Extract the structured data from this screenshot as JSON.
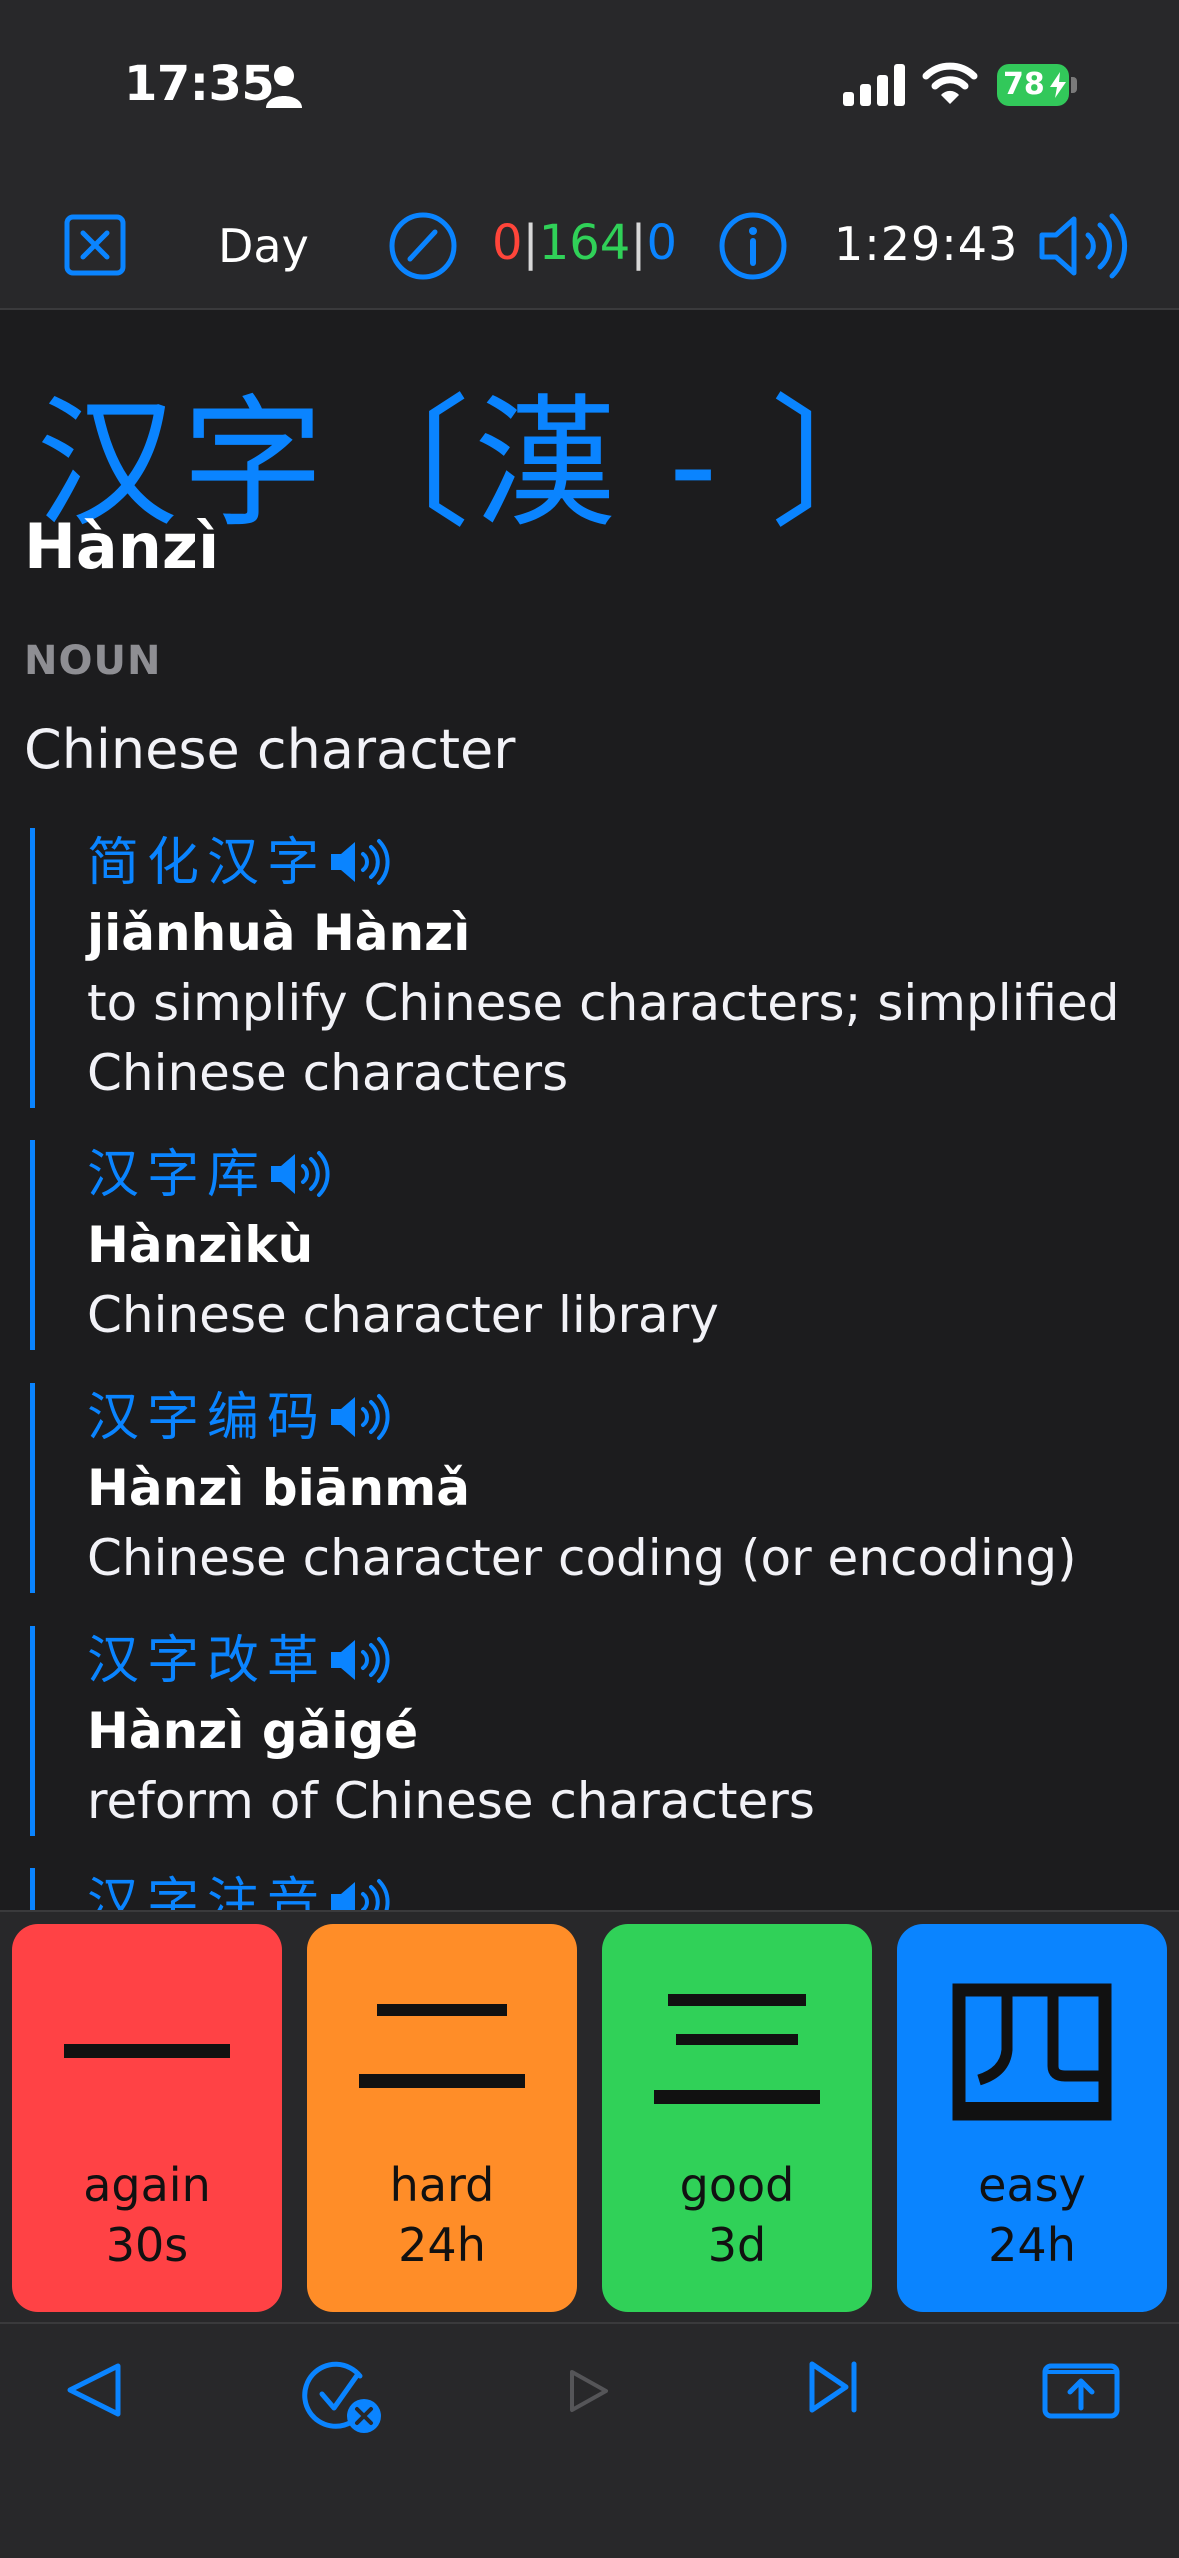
{
  "status_bar": {
    "time": "17:35",
    "battery": "78"
  },
  "toolbar": {
    "deck": "Day",
    "counts": {
      "new": "0",
      "learn": "164",
      "review": "0",
      "sep1": "|",
      "sep2": "|"
    },
    "timer": "1:29:43"
  },
  "card": {
    "headword": "汉字〔漢 - 〕",
    "pinyin": "Hànzì",
    "part_of_speech": "NOUN",
    "meaning": "Chinese character",
    "examples": [
      {
        "hanzi": "简化汉字",
        "pinyin_plain": "jiǎnhuà ",
        "pinyin_bold": "Hànzì",
        "meaning_line1": "to simplify Chinese characters; simplified",
        "meaning_line2": "Chinese characters"
      },
      {
        "hanzi": "汉字库",
        "pinyin_plain": "",
        "pinyin_bold": "Hànzìkù",
        "meaning_line1": "Chinese character library",
        "meaning_line2": ""
      },
      {
        "hanzi": "汉字编码",
        "pinyin_plain": " biānmǎ",
        "pinyin_bold": "Hànzì",
        "meaning_line1": "Chinese character coding (or encoding)",
        "meaning_line2": ""
      },
      {
        "hanzi": "汉字改革",
        "pinyin_plain": " gǎigé",
        "pinyin_bold": "Hànzì",
        "meaning_line1": "reform of Chinese characters",
        "meaning_line2": ""
      },
      {
        "hanzi": "汉字注音",
        "pinyin_plain": "",
        "pinyin_bold": "",
        "meaning_line1": "",
        "meaning_line2": ""
      }
    ]
  },
  "answers": [
    {
      "glyph": "一",
      "label": "again",
      "interval": "30s",
      "color": "#ff4245"
    },
    {
      "glyph": "二",
      "label": "hard",
      "interval": "24h",
      "color": "#ff8d28"
    },
    {
      "glyph": "三",
      "label": "good",
      "interval": "3d",
      "color": "#30d158"
    },
    {
      "glyph": "四",
      "label": "easy",
      "interval": "24h",
      "color": "#0a84ff"
    }
  ],
  "colors": {
    "accent": "#0a84ff",
    "background": "#1c1c1e",
    "bar": "#28282a",
    "new": "#ff453a",
    "learn": "#30d158",
    "review": "#0a84ff"
  }
}
